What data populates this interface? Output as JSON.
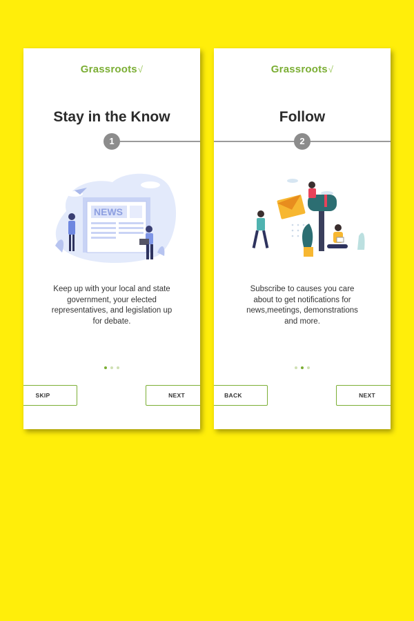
{
  "brand": {
    "name": "Grassroots",
    "leaf": "√"
  },
  "colors": {
    "background": "#FFEE0A",
    "accent": "#7BAE34",
    "step": "#8c8c8c"
  },
  "screens": [
    {
      "title": "Stay in the Know",
      "step": "1",
      "illustration_text": "NEWS",
      "description": "Keep up with your local and state government, your elected representatives, and legislation up for debate.",
      "active_dot": 1,
      "left_button": "SKIP",
      "right_button": "NEXT"
    },
    {
      "title": "Follow",
      "step": "2",
      "description": "Subscribe to causes you care about to get notifications for news,meetings, demonstrations and more.",
      "active_dot": 2,
      "left_button": "BACK",
      "right_button": "NEXT"
    }
  ]
}
